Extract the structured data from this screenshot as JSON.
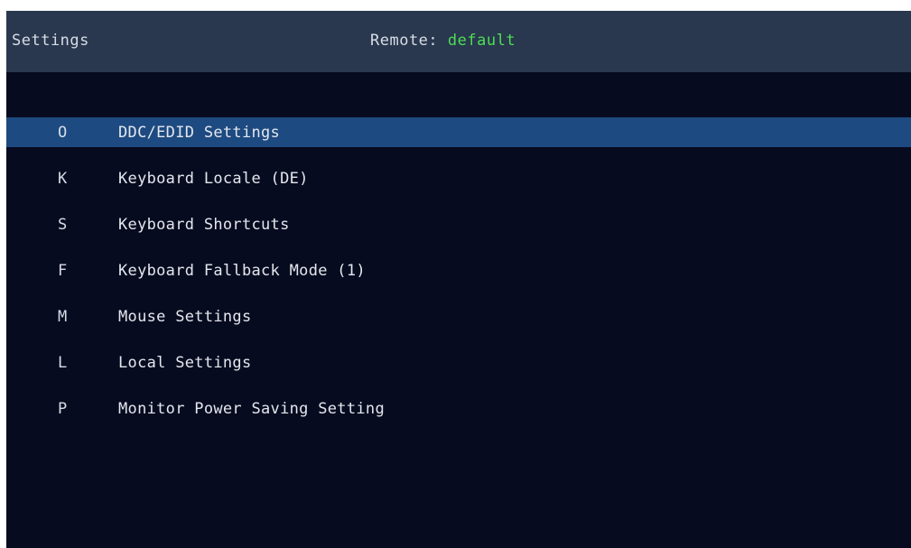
{
  "header": {
    "title": "Settings",
    "remote_label": "Remote:",
    "remote_value": "default"
  },
  "colors": {
    "background": "#070b1f",
    "header_bar": "#29384e",
    "selection": "#1d4a80",
    "remote_value": "#4ddd55",
    "text": "#e4e7ee"
  },
  "menu": {
    "selected_index": 0,
    "items": [
      {
        "key": "O",
        "label": "DDC/EDID Settings"
      },
      {
        "key": "K",
        "label": "Keyboard Locale (DE)"
      },
      {
        "key": "S",
        "label": "Keyboard Shortcuts"
      },
      {
        "key": "F",
        "label": "Keyboard Fallback Mode (1)"
      },
      {
        "key": "M",
        "label": "Mouse Settings"
      },
      {
        "key": "L",
        "label": "Local Settings"
      },
      {
        "key": "P",
        "label": "Monitor Power Saving Setting"
      }
    ]
  }
}
